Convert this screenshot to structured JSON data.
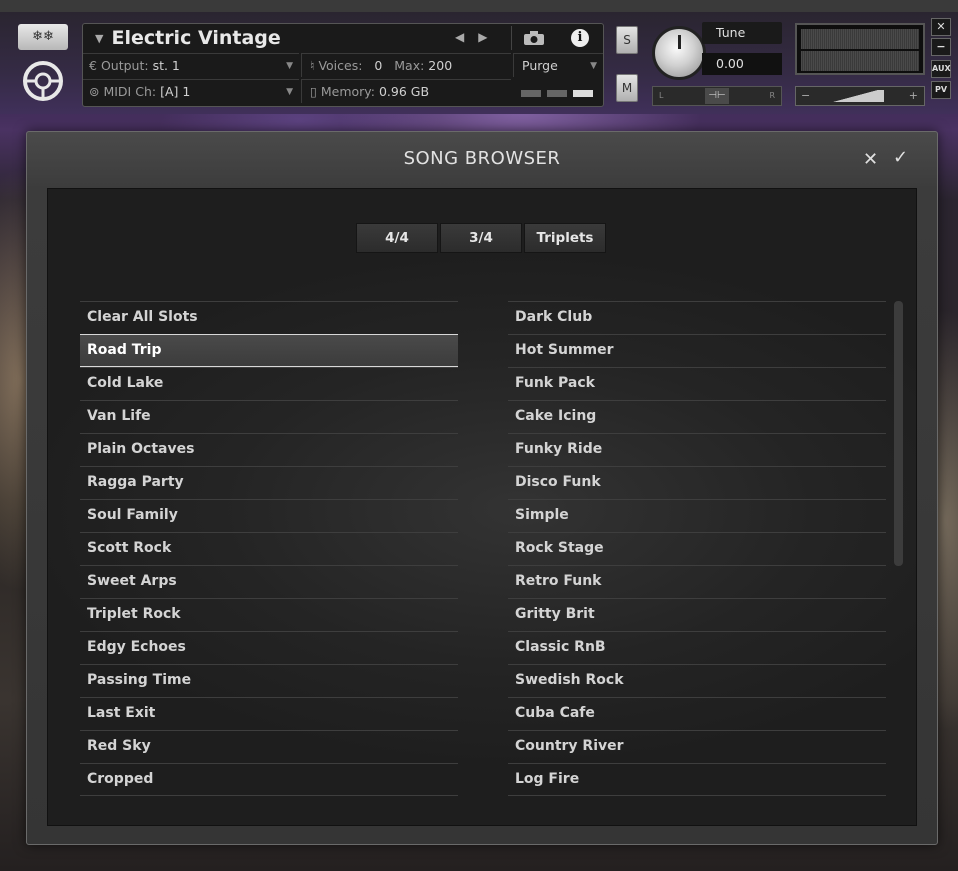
{
  "header": {
    "instrument_name": "Electric Vintage",
    "output_label": "Output:",
    "output_value": "st. 1",
    "midi_label": "MIDI Ch:",
    "midi_value": "[A] 1",
    "voices_label": "Voices:",
    "voices_value": "0",
    "max_label": "Max:",
    "max_value": "200",
    "memory_label": "Memory:",
    "memory_value": "0.96 GB",
    "purge_label": "Purge",
    "solo_label": "S",
    "mute_label": "M",
    "tune_label": "Tune",
    "tune_value": "0.00",
    "pan_left": "L",
    "pan_right": "R",
    "aux_label": "AUX",
    "pv_label": "PV"
  },
  "dialog": {
    "title": "SONG BROWSER",
    "tabs": [
      "4/4",
      "3/4",
      "Triplets"
    ],
    "left_items": [
      "Clear All Slots",
      "Road Trip",
      "Cold Lake",
      "Van Life",
      "Plain Octaves",
      "Ragga Party",
      "Soul Family",
      "Scott Rock",
      "Sweet Arps",
      "Triplet Rock",
      "Edgy Echoes",
      "Passing Time",
      "Last Exit",
      "Red Sky",
      "Cropped"
    ],
    "right_items": [
      "Dark Club",
      "Hot Summer",
      "Funk Pack",
      "Cake Icing",
      "Funky Ride",
      "Disco Funk",
      "Simple",
      "Rock Stage",
      "Retro Funk",
      "Gritty Brit",
      "Classic RnB",
      "Swedish Rock",
      "Cuba Cafe",
      "Country River",
      "Log Fire"
    ],
    "selected_item": "Road Trip"
  }
}
